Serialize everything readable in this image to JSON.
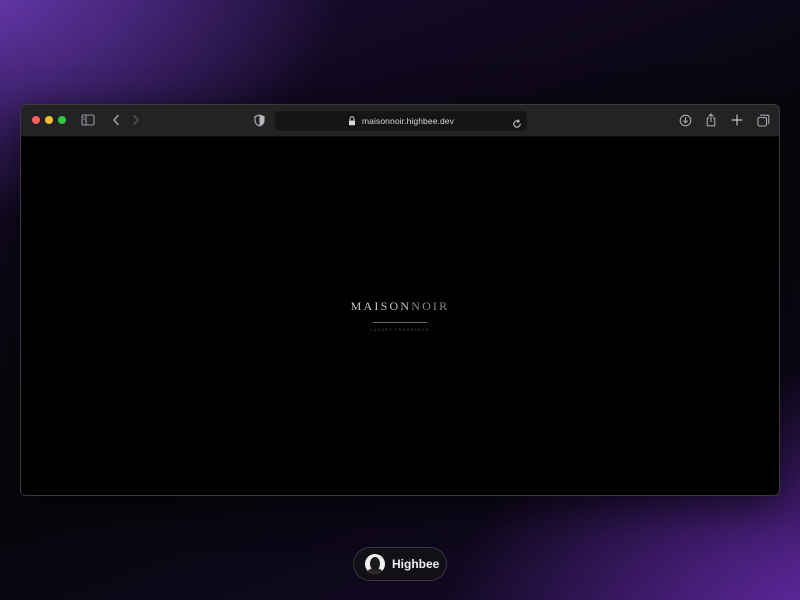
{
  "browser": {
    "url": "maisonnoir.highbee.dev"
  },
  "page": {
    "brand_part1": "MAISON",
    "brand_part2": "NOIR",
    "tagline": "LUXURY FRAGRANCE"
  },
  "badge": {
    "name": "Highbee"
  },
  "icons": [
    "sidebar-icon",
    "back-icon",
    "forward-icon",
    "shield-icon",
    "lock-icon",
    "reload-icon",
    "download-icon",
    "share-icon",
    "new-tab-icon",
    "tabs-overview-icon"
  ],
  "colors": {
    "window_bg": "#000000",
    "toolbar_bg": "#232325",
    "traffic_red": "#ff5f57",
    "traffic_yellow": "#febc2e",
    "traffic_green": "#28c840",
    "accent_purple": "#6a3bb4"
  }
}
